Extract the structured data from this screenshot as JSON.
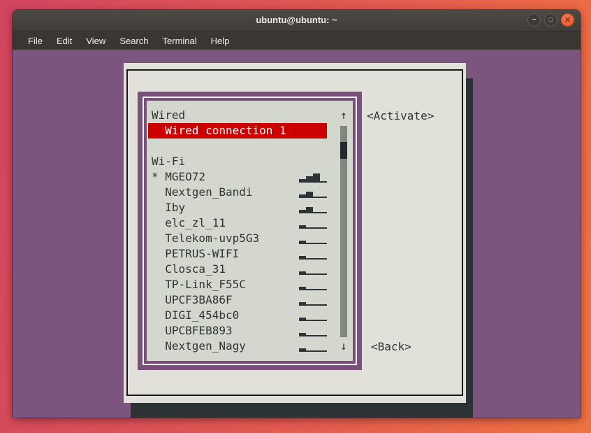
{
  "window": {
    "title": "ubuntu@ubuntu: ~",
    "menu": [
      "File",
      "Edit",
      "View",
      "Search",
      "Terminal",
      "Help"
    ],
    "controls": {
      "minimize_icon": "–",
      "maximize_icon": "□",
      "close_icon": "✕"
    }
  },
  "colors": {
    "selection_red": "#CC0000",
    "terminal_background": "#7B557E",
    "dialog_background": "#E1E1DA",
    "list_background": "#D4D7CE",
    "frame_purple": "#7A4E7D",
    "text_dark": "#2E3436",
    "close_button_orange": "#E8542A",
    "scrollbar_track": "#7E887E"
  },
  "dialog": {
    "activate_button": "<Activate>",
    "back_button": "<Back>",
    "list": {
      "scroll_up_icon": "↑",
      "scroll_down_icon": "↓",
      "active_marker": "*",
      "rows": [
        {
          "type": "group",
          "label": "Wired"
        },
        {
          "type": "item",
          "label": "Wired connection 1",
          "selected": true
        },
        {
          "type": "spacer",
          "label": ""
        },
        {
          "type": "group",
          "label": "Wi-Fi"
        },
        {
          "type": "item",
          "label": "MGEO72",
          "marker": "*",
          "signal": "▂▄▆_"
        },
        {
          "type": "item",
          "label": "Nextgen_Bandi",
          "signal": "▂▄__"
        },
        {
          "type": "item",
          "label": "Iby",
          "signal": "▂▄__"
        },
        {
          "type": "item",
          "label": "elc_zl_11",
          "signal": "▂___"
        },
        {
          "type": "item",
          "label": "Telekom-uvp5G3",
          "signal": "▂___"
        },
        {
          "type": "item",
          "label": "PETRUS-WIFI",
          "signal": "▂___"
        },
        {
          "type": "item",
          "label": "Closca_31",
          "signal": "▂___"
        },
        {
          "type": "item",
          "label": "TP-Link_F55C",
          "signal": "▂___"
        },
        {
          "type": "item",
          "label": "UPCF3BA86F",
          "signal": "▂___"
        },
        {
          "type": "item",
          "label": "DIGI_454bc0",
          "signal": "▂___"
        },
        {
          "type": "item",
          "label": "UPCBFEB893",
          "signal": "▂___"
        },
        {
          "type": "item",
          "label": "Nextgen_Nagy",
          "signal": "▂___"
        }
      ]
    }
  }
}
